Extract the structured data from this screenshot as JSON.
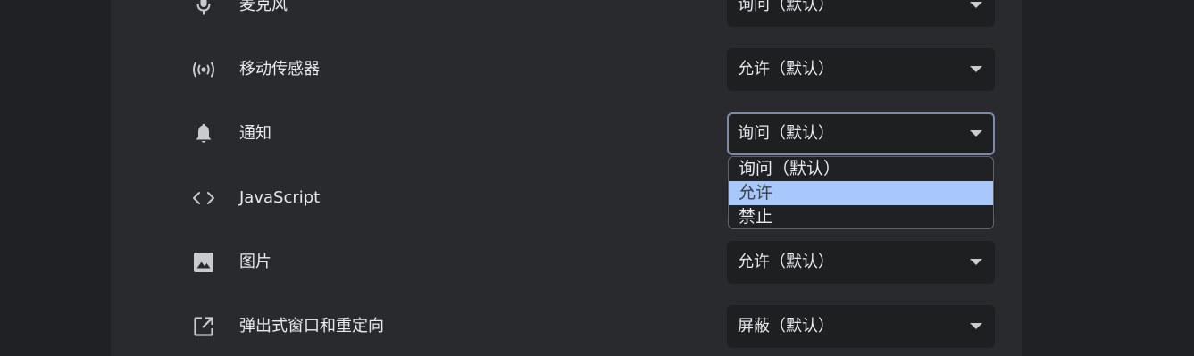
{
  "settings": {
    "rows": [
      {
        "label": "麦克风",
        "icon": "microphone-icon",
        "value": "询问（默认）"
      },
      {
        "label": "移动传感器",
        "icon": "motion-sensor-icon",
        "value": "允许（默认）"
      },
      {
        "label": "通知",
        "icon": "bell-icon",
        "value": "询问（默认）"
      },
      {
        "label": "JavaScript",
        "icon": "code-brackets-icon",
        "value": ""
      },
      {
        "label": "图片",
        "icon": "image-icon",
        "value": "允许（默认）"
      },
      {
        "label": "弹出式窗口和重定向",
        "icon": "open-in-new-icon",
        "value": "屏蔽（默认）"
      }
    ],
    "dropdown": {
      "options": [
        "询问（默认）",
        "允许",
        "禁止"
      ],
      "highlighted": "允许"
    }
  },
  "colors": {
    "background": "#202124",
    "card": "#292a2d",
    "select_bg": "#1e1f21",
    "focus_border": "#7d8ba6",
    "highlight": "#a8c7fa"
  }
}
